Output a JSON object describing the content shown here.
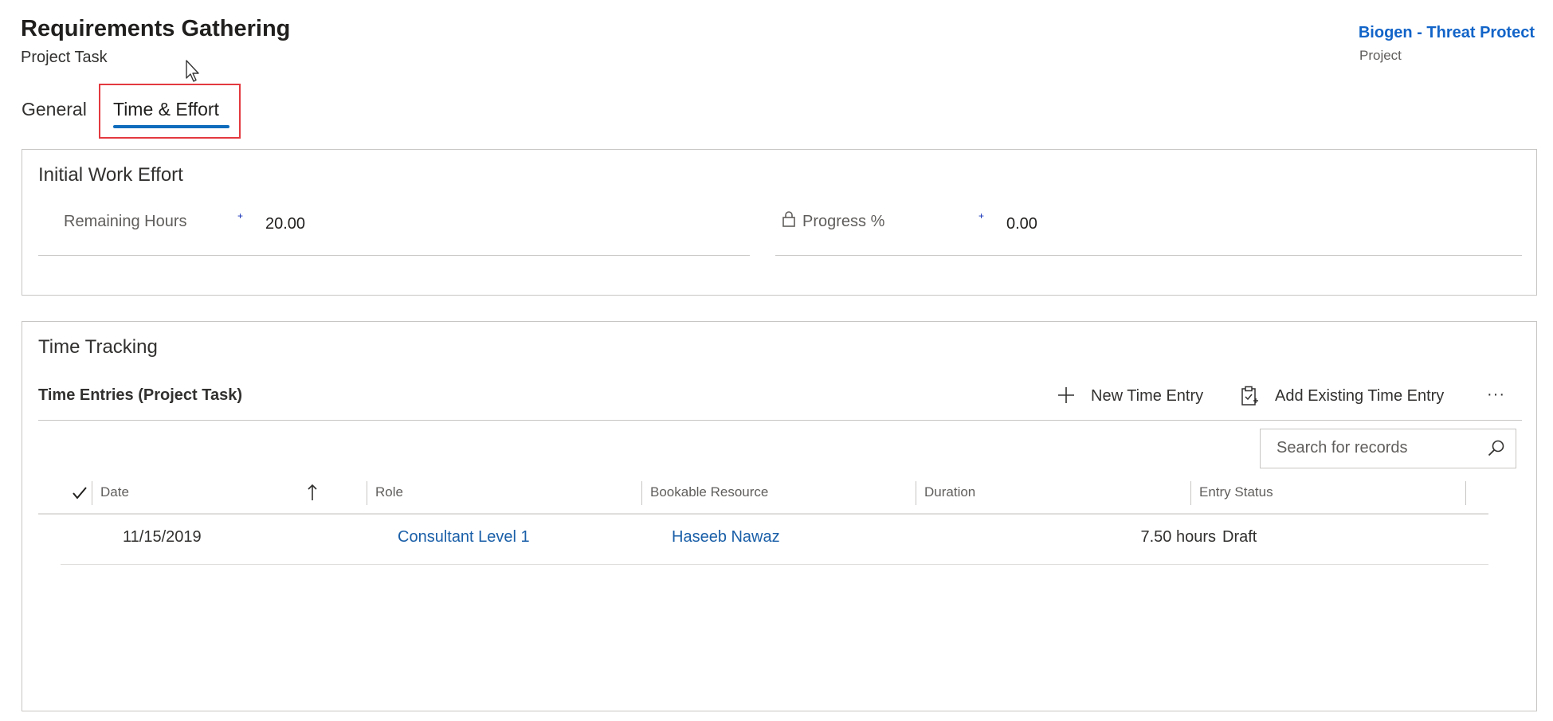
{
  "header": {
    "title": "Requirements Gathering",
    "subtitle": "Project Task",
    "project_link": "Biogen - Threat Protect",
    "project_type": "Project"
  },
  "tabs": [
    {
      "label": "General"
    },
    {
      "label": "Time & Effort"
    }
  ],
  "initial_work_effort": {
    "title": "Initial Work Effort",
    "remaining_hours_label": "Remaining Hours",
    "remaining_hours_value": "20.00",
    "progress_label": "Progress %",
    "progress_value": "0.00",
    "required_mark": "+"
  },
  "time_tracking": {
    "title": "Time Tracking",
    "subgrid_title": "Time Entries (Project Task)",
    "new_entry_label": "New Time Entry",
    "add_existing_label": "Add Existing Time Entry",
    "more_label": "···",
    "search_placeholder": "Search for records",
    "columns": [
      "Date",
      "Role",
      "Bookable Resource",
      "Duration",
      "Entry Status"
    ],
    "rows": [
      {
        "date": "11/15/2019",
        "role": "Consultant Level 1",
        "resource": "Haseeb Nawaz",
        "duration": "7.50 hours",
        "status": "Draft"
      }
    ]
  },
  "colors": {
    "accent": "#0f6cbd",
    "link": "#1264c8",
    "highlight": "#e3393f"
  }
}
